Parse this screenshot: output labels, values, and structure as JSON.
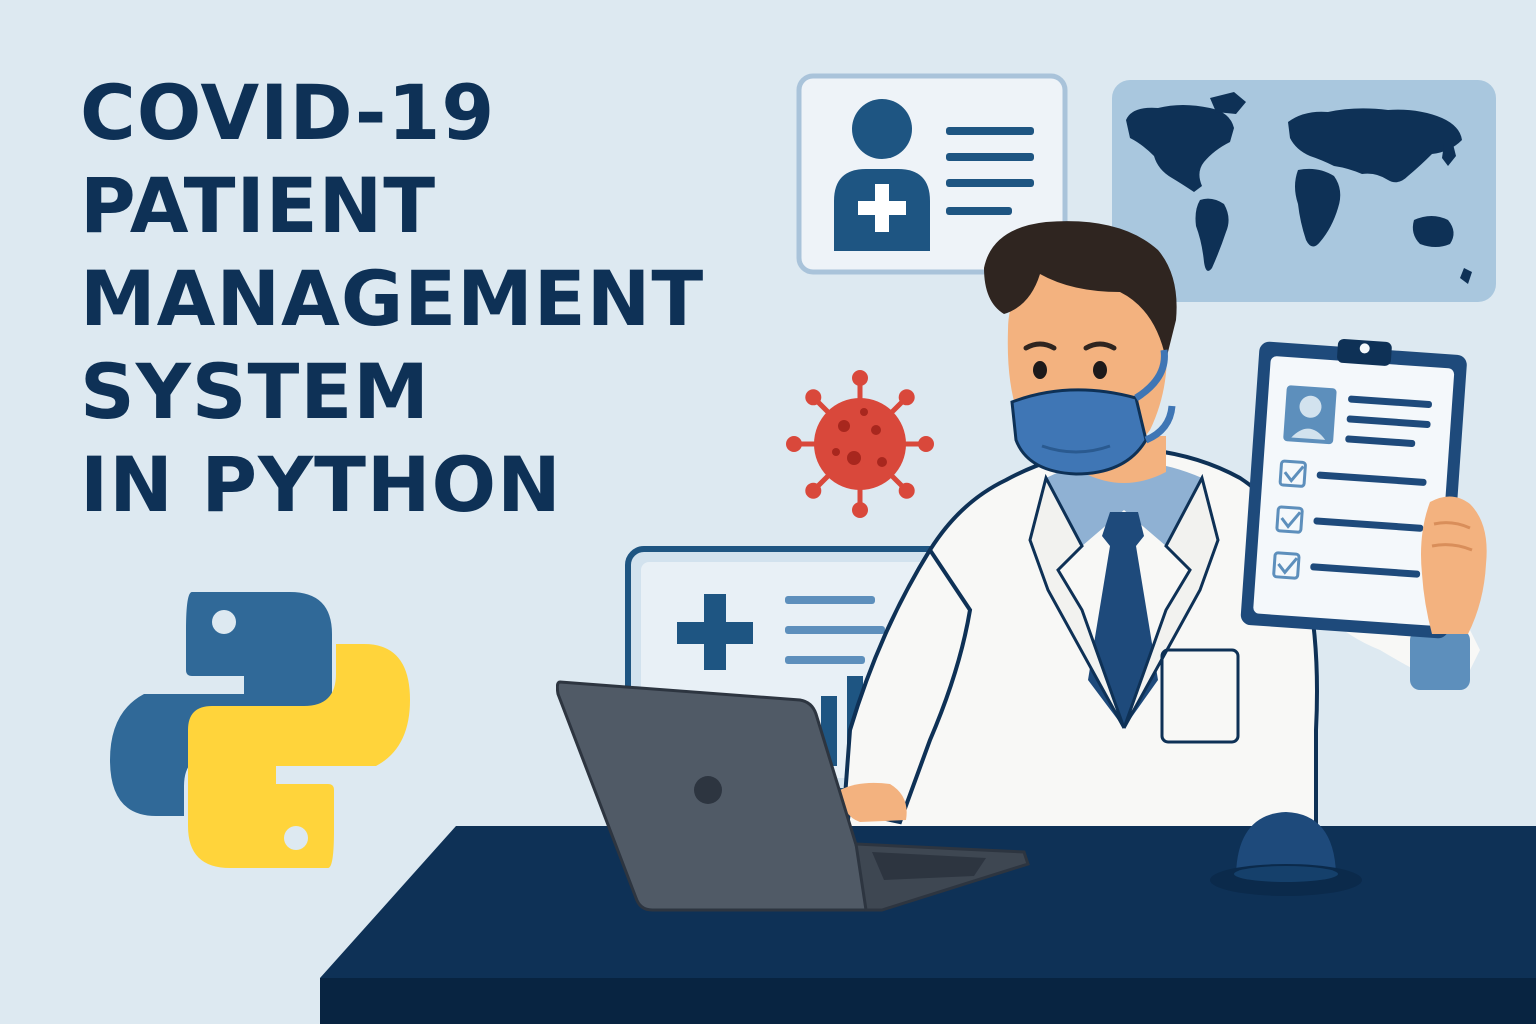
{
  "title_lines": [
    "COVID-19",
    "PATIENT",
    "MANAGEMENT",
    "SYSTEM",
    "IN PYTHON"
  ],
  "icons": {
    "python_logo": "python-logo-icon",
    "patient_card": "patient-id-card-icon",
    "world_map": "world-map-icon",
    "virus": "coronavirus-icon",
    "clipboard": "checklist-clipboard-icon",
    "medical_monitor": "medical-monitor-icon",
    "laptop": "laptop-icon",
    "bell": "desk-bell-icon"
  },
  "colors": {
    "background": "#dde9f1",
    "navy": "#0e3156",
    "mid_blue": "#1e5582",
    "python_blue": "#306998",
    "python_yellow": "#ffd43b",
    "virus_red": "#d9483b",
    "mask_blue": "#3f76b5",
    "coat_white": "#f8f8f6",
    "skin": "#f3b27f"
  }
}
